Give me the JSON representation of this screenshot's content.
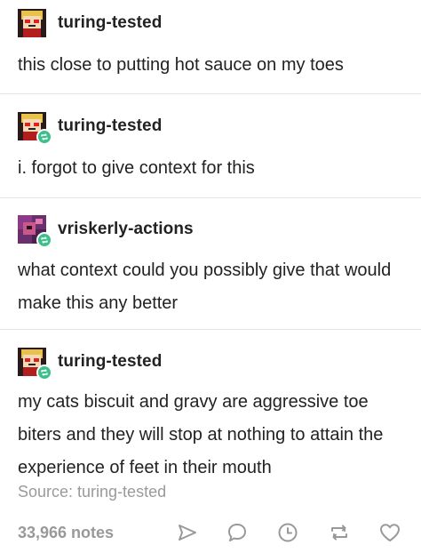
{
  "posts": [
    {
      "username": "turing-tested",
      "text": "this close to putting hot sauce on my toes",
      "reblog": false,
      "avatar": "pixel-art-avatar-red"
    },
    {
      "username": "turing-tested",
      "text": "i. forgot to give context for this",
      "reblog": true,
      "avatar": "pixel-art-avatar-red"
    },
    {
      "username": "vriskerly-actions",
      "text": "what context could you possibly give that would make this any better",
      "reblog": true,
      "avatar": "pixel-art-avatar-purple"
    },
    {
      "username": "turing-tested",
      "text": "my cats biscuit and gravy are aggressive toe biters and they will stop at nothing to attain the experience of feet in their mouth",
      "reblog": true,
      "avatar": "pixel-art-avatar-red"
    }
  ],
  "source": "Source: turing-tested",
  "footer": {
    "notes": "33,966 notes",
    "actions": [
      "share-icon",
      "reply-icon",
      "schedule-icon",
      "reblog-icon",
      "like-icon"
    ]
  },
  "colors": {
    "text": "#222222",
    "muted": "#999999",
    "reblog_green": "#3cbf8a",
    "divider": "#e6e6e6"
  }
}
